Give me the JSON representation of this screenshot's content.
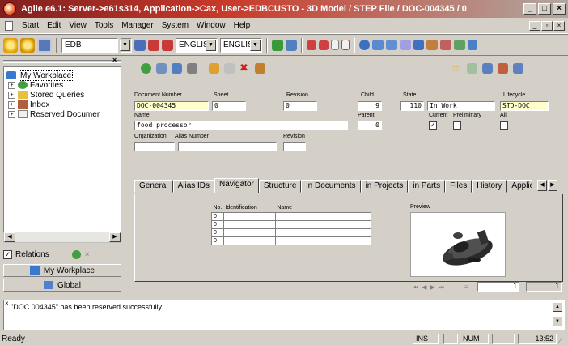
{
  "window": {
    "title": "Agile e6.1: Server->e61s314, Application->Cax, User->EDBCUSTO - 3D Model / STEP File / DOC-004345 / 0"
  },
  "menu": {
    "items": [
      "Start",
      "Edit",
      "View",
      "Tools",
      "Manager",
      "System",
      "Window",
      "Help"
    ]
  },
  "toolbar": {
    "db_combo": "EDB",
    "lang_combo_1": "ENGLIS",
    "lang_combo_2": "ENGLIS"
  },
  "tree": {
    "items": [
      {
        "label": "My Workplace",
        "level": 0,
        "selected": true,
        "expander": ""
      },
      {
        "label": "Favorites",
        "level": 1,
        "expander": "+"
      },
      {
        "label": "Stored Queries",
        "level": 1,
        "expander": "+"
      },
      {
        "label": "Inbox",
        "level": 1,
        "expander": "+"
      },
      {
        "label": "Reserved Documer",
        "level": 1,
        "expander": "+"
      }
    ]
  },
  "left": {
    "relations_label": "Relations",
    "relations_checked": "✓",
    "nav_workplace": "My Workplace",
    "nav_global": "Global"
  },
  "form": {
    "doc_number_label": "Document Number",
    "doc_number": "DOC-004345",
    "sheet_label": "Sheet",
    "sheet": "0",
    "revision_label": "Revision",
    "revision": "0",
    "child_label": "Child",
    "child": "9",
    "state_label": "State",
    "state_code": "110",
    "state_name": "In Work",
    "lifecycle_label": "Lifecycle",
    "lifecycle": "STD-DOC",
    "name_label": "Name",
    "name": "food processor",
    "parent_label": "Parent",
    "parent": "0",
    "current_label": "Current",
    "preliminary_label": "Preliminary",
    "all_label": "All",
    "current_checked": "✓",
    "org_label": "Organization",
    "alias_label": "Alias Number",
    "revision2_label": "Revision"
  },
  "tabs": [
    "General",
    "Alias IDs",
    "Navigator",
    "Structure",
    "in Documents",
    "in Projects",
    "in Parts",
    "Files",
    "History",
    "Applic"
  ],
  "active_tab": "Navigator",
  "navigator": {
    "col_no": "No.",
    "col_ident": "Identification",
    "col_name": "Name",
    "rows": [
      "0",
      "0",
      "0",
      "0"
    ],
    "preview_label": "Preview"
  },
  "pager": {
    "page": "1",
    "total": "1"
  },
  "messages": {
    "text": "\"DOC 004345\" has been reserved successfully."
  },
  "status": {
    "text": "Ready",
    "ins": "INS",
    "num": "NUM",
    "time": "13:52"
  }
}
